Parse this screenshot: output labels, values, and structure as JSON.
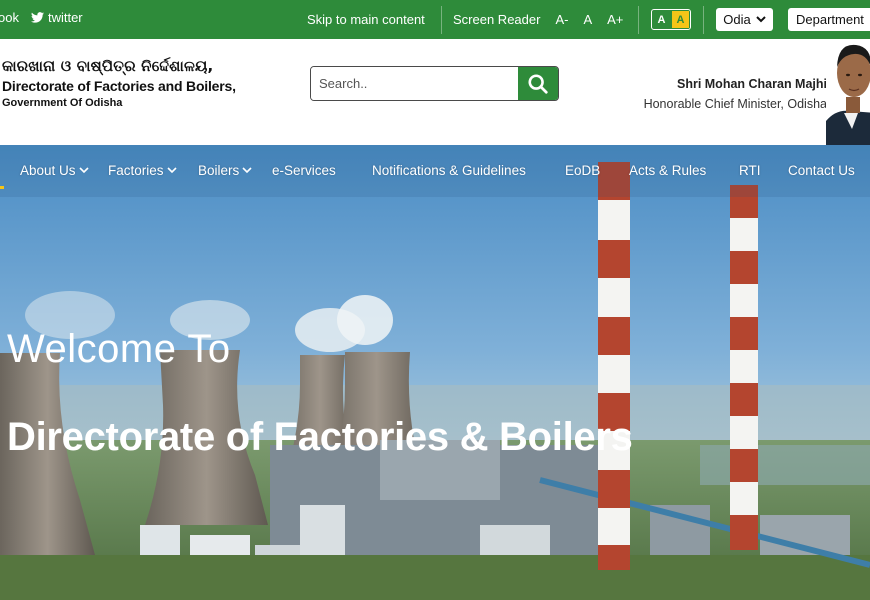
{
  "topbar": {
    "facebook": "ook",
    "twitter": "twitter",
    "skip": "Skip to main content",
    "screen_reader": "Screen Reader",
    "font_decrease": "A-",
    "font_normal": "A",
    "font_increase": "A+",
    "contrast_normal": "A",
    "contrast_high": "A",
    "language": "Odia",
    "department": "Department"
  },
  "header": {
    "brand_odia": "କାରଖାନା ଓ ବାଷ୍ପିତ୍ର ନିର୍ଦ୍ଦେଶାଳୟ,",
    "brand_en": "Directorate of Factories and Boilers,",
    "brand_gov": "Government  Of Odisha",
    "search_placeholder": "Search..",
    "cm_name": "Shri Mohan Charan Majhi",
    "cm_role": "Honorable Chief Minister, Odisha"
  },
  "nav": {
    "items": [
      {
        "label": "About Us"
      },
      {
        "label": "Factories"
      },
      {
        "label": "Boilers"
      },
      {
        "label": "e-Services"
      },
      {
        "label": "Notifications & Guidelines"
      },
      {
        "label": "EoDB"
      },
      {
        "label": "Acts & Rules"
      },
      {
        "label": "RTI"
      },
      {
        "label": "Contact Us"
      }
    ]
  },
  "hero": {
    "welcome": "Welcome To",
    "title": "Directorate of Factories & Boilers"
  },
  "colors": {
    "brand_green": "#2e8b3a",
    "accent_yellow": "#f5c518"
  },
  "icons": [
    "twitter-icon",
    "search-icon",
    "chevron-down-icon",
    "factory-photo"
  ]
}
